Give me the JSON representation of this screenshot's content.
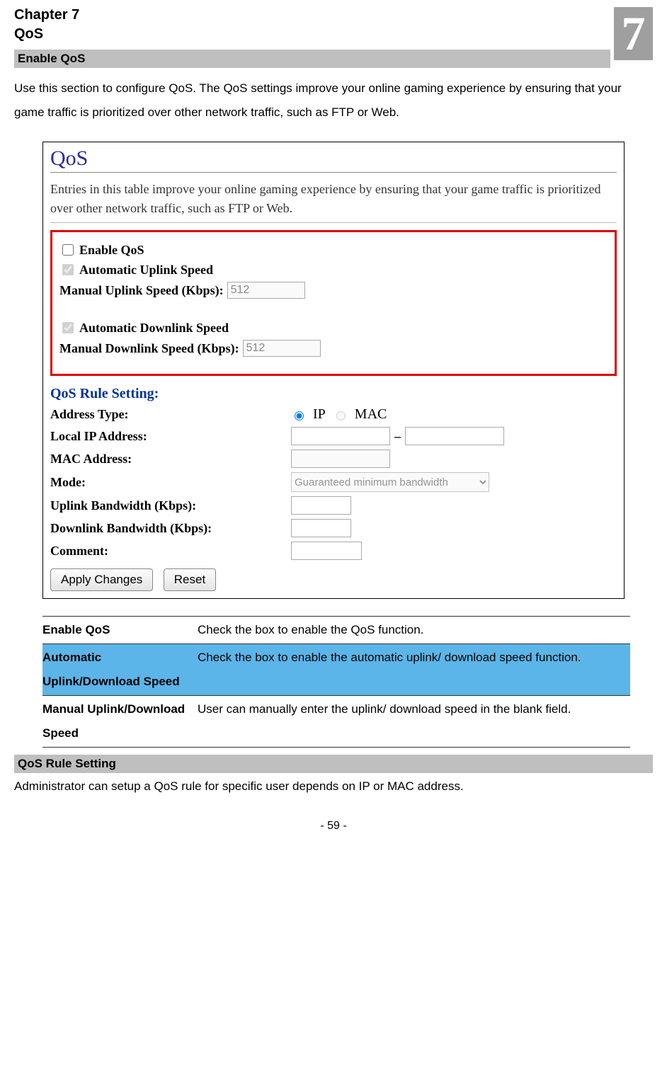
{
  "chapter": {
    "label": "Chapter 7",
    "title": "QoS",
    "number": "7"
  },
  "sections": {
    "enable_qos_header": "Enable QoS",
    "intro": "Use this section to configure QoS. The QoS settings improve your online gaming experience by ensuring that your game traffic is prioritized over other network traffic, such as FTP or Web.",
    "qos_rule_header": "QoS Rule Setting",
    "rule_desc": "Administrator can setup a QoS rule for specific user depends on IP or MAC address."
  },
  "ui": {
    "title": "QoS",
    "description": "Entries in this table improve your online gaming experience by ensuring that your game traffic is prioritized over other network traffic, such as FTP or Web.",
    "enable_qos": "Enable QoS",
    "auto_uplink": "Automatic Uplink Speed",
    "manual_uplink_label": "Manual Uplink Speed (Kbps):",
    "manual_uplink_value": "512",
    "auto_downlink": "Automatic Downlink Speed",
    "manual_downlink_label": "Manual Downlink Speed (Kbps):",
    "manual_downlink_value": "512",
    "rule_setting_label": "QoS Rule Setting:",
    "address_type_label": "Address Type:",
    "radio_ip": "IP",
    "radio_mac": "MAC",
    "local_ip_label": "Local IP Address:",
    "mac_label": "MAC Address:",
    "mode_label": "Mode:",
    "mode_option": "Guaranteed minimum bandwidth",
    "uplink_bw_label": "Uplink Bandwidth (Kbps):",
    "downlink_bw_label": "Downlink Bandwidth (Kbps):",
    "comment_label": "Comment:",
    "apply_btn": "Apply Changes",
    "reset_btn": "Reset"
  },
  "table": [
    {
      "key": "Enable QoS",
      "val": "Check the box to enable the QoS function."
    },
    {
      "key": "Automatic Uplink/Download Speed",
      "val": "Check the box to enable the automatic uplink/ download speed function."
    },
    {
      "key": "Manual Uplink/Download Speed",
      "val": "User can manually enter the uplink/ download speed in the blank field."
    }
  ],
  "page_number": "- 59 -"
}
